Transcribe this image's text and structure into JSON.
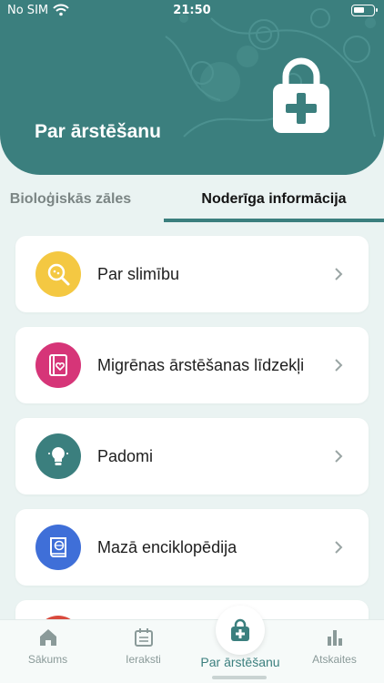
{
  "status_bar": {
    "carrier": "No SIM",
    "time": "21:50"
  },
  "header": {
    "title": "Par ārstēšanu"
  },
  "tabs": [
    {
      "label": "Bioloģiskās zāles",
      "active": false
    },
    {
      "label": "Noderīga informācija",
      "active": true
    }
  ],
  "menu": [
    {
      "label": "Par slimību",
      "icon": "magnifier-icon",
      "color": "#f4c842"
    },
    {
      "label": "Migrēnas ārstēšanas līdzekļi",
      "icon": "book-heart-icon",
      "color": "#d63578"
    },
    {
      "label": "Padomi",
      "icon": "lightbulb-icon",
      "color": "#3b7f7e"
    },
    {
      "label": "Mazā enciklopēdija",
      "icon": "encyclopedia-icon",
      "color": "#3f6fd8"
    }
  ],
  "bottom_nav": [
    {
      "label": "Sākums",
      "icon": "home-icon",
      "active": false
    },
    {
      "label": "Ieraksti",
      "icon": "calendar-icon",
      "active": false
    },
    {
      "label": "Par ārstēšanu",
      "icon": "medical-bag-icon",
      "active": true
    },
    {
      "label": "Atskaites",
      "icon": "bar-chart-icon",
      "active": false
    }
  ],
  "colors": {
    "primary": "#3b7f7e",
    "background": "#eaf3f2"
  }
}
